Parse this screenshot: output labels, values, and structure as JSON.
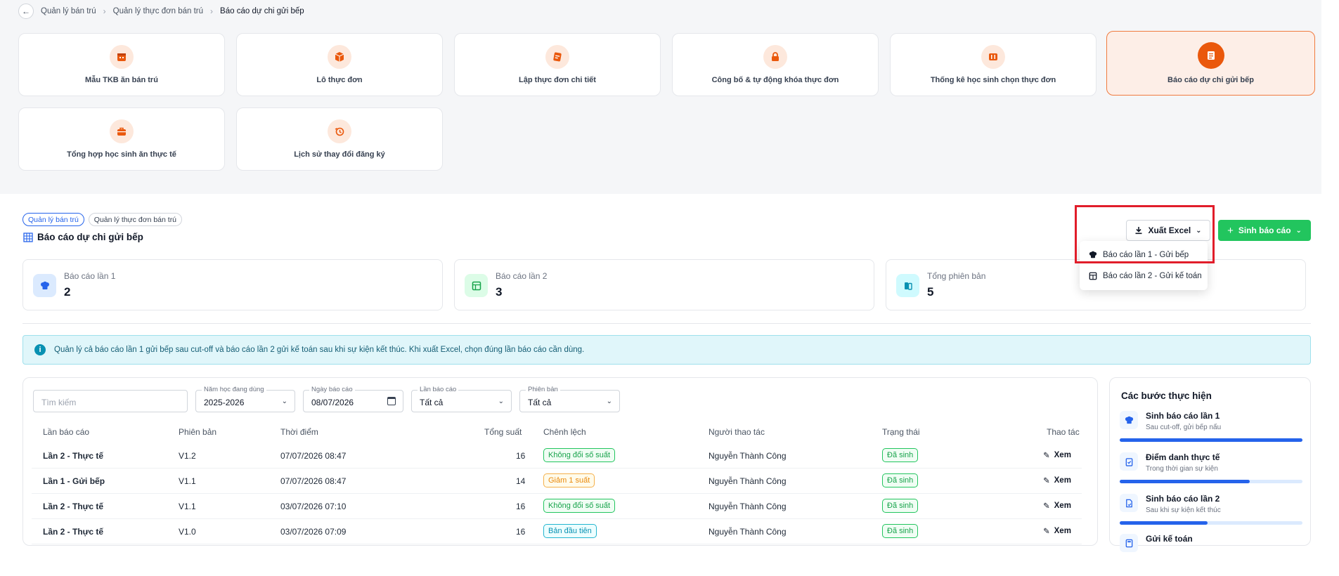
{
  "breadcrumb": [
    "Quản lý bán trú",
    "Quản lý thực đơn bán trú",
    "Báo cáo dự chi gửi bếp"
  ],
  "tiles": [
    {
      "label": "Mẫu TKB ăn bán trú",
      "icon": "calendar-icon"
    },
    {
      "label": "Lô thực đơn",
      "icon": "box-icon"
    },
    {
      "label": "Lập thực đơn chi tiết",
      "icon": "notes-icon"
    },
    {
      "label": "Công bố & tự động khóa thực đơn",
      "icon": "lock-icon"
    },
    {
      "label": "Thống kê học sinh chọn thực đơn",
      "icon": "columns-icon"
    },
    {
      "label": "Báo cáo dự chi gửi bếp",
      "icon": "report-icon",
      "active": true
    },
    {
      "label": "Tổng hợp học sinh ăn thực tế",
      "icon": "briefcase-icon"
    },
    {
      "label": "Lịch sử thay đổi đăng ký",
      "icon": "history-icon"
    }
  ],
  "tags": [
    "Quản lý bán trú",
    "Quản lý thực đơn bán trú"
  ],
  "page_title": "Báo cáo dự chi gửi bếp",
  "actions": {
    "export_label": "Xuất Excel",
    "generate_label": "Sinh báo cáo"
  },
  "export_menu": [
    "Báo cáo lần 1 - Gửi bếp",
    "Báo cáo lần 2 - Gửi kế toán"
  ],
  "stats": [
    {
      "label": "Báo cáo lần 1",
      "value": "2",
      "color": "#2563eb"
    },
    {
      "label": "Báo cáo lần 2",
      "value": "3",
      "color": "#16a34a"
    },
    {
      "label": "Tổng phiên bản",
      "value": "5",
      "color": "#0891b2"
    }
  ],
  "info_text": "Quản lý cả báo cáo lần 1 gửi bếp sau cut-off và báo cáo lần 2 gửi kế toán sau khi sự kiện kết thúc. Khi xuất Excel, chọn đúng lần báo cáo cần dùng.",
  "filters": {
    "search_placeholder": "Tìm kiếm",
    "school_year": {
      "label": "Năm học đang dùng",
      "value": "2025-2026"
    },
    "report_date": {
      "label": "Ngày báo cáo",
      "value": "08/07/2026"
    },
    "report_round": {
      "label": "Lần báo cáo",
      "value": "Tất cả"
    },
    "version": {
      "label": "Phiên bản",
      "value": "Tất cả"
    }
  },
  "table": {
    "columns": [
      "Lần báo cáo",
      "Phiên bản",
      "Thời điểm",
      "Tổng suất",
      "Chênh lệch",
      "Người thao tác",
      "Trạng thái",
      "Thao tác"
    ],
    "rows": [
      {
        "round": "Lần 2 - Thực tế",
        "version": "V1.2",
        "time": "07/07/2026 08:47",
        "total": "16",
        "diff": "Không đổi số suất",
        "diff_type": "green",
        "user": "Nguyễn Thành Công",
        "status": "Đã sinh",
        "action": "Xem"
      },
      {
        "round": "Lần 1 - Gửi bếp",
        "version": "V1.1",
        "time": "07/07/2026 08:47",
        "total": "14",
        "diff": "Giảm 1 suất",
        "diff_type": "orange",
        "user": "Nguyễn Thành Công",
        "status": "Đã sinh",
        "action": "Xem"
      },
      {
        "round": "Lần 2 - Thực tế",
        "version": "V1.1",
        "time": "03/07/2026 07:10",
        "total": "16",
        "diff": "Không đổi số suất",
        "diff_type": "green",
        "user": "Nguyễn Thành Công",
        "status": "Đã sinh",
        "action": "Xem"
      },
      {
        "round": "Lần 2 - Thực tế",
        "version": "V1.0",
        "time": "03/07/2026 07:09",
        "total": "16",
        "diff": "Bản đầu tiên",
        "diff_type": "cyan",
        "user": "Nguyễn Thành Công",
        "status": "Đã sinh",
        "action": "Xem"
      }
    ]
  },
  "steps_panel": {
    "title": "Các bước thực hiện",
    "steps": [
      {
        "name": "Sinh báo cáo lần 1",
        "desc": "Sau cut-off, gửi bếp nấu",
        "progress": 1.0,
        "icon": "chef-hat-icon"
      },
      {
        "name": "Điểm danh thực tế",
        "desc": "Trong thời gian sự kiện",
        "progress": 0.71,
        "icon": "clipboard-check-icon"
      },
      {
        "name": "Sinh báo cáo lần 2",
        "desc": "Sau khi sự kiện kết thúc",
        "progress": 0.48,
        "icon": "file-chart-icon"
      },
      {
        "name": "Gửi kế toán",
        "desc": "",
        "progress": 0,
        "icon": "calculator-icon"
      }
    ]
  }
}
